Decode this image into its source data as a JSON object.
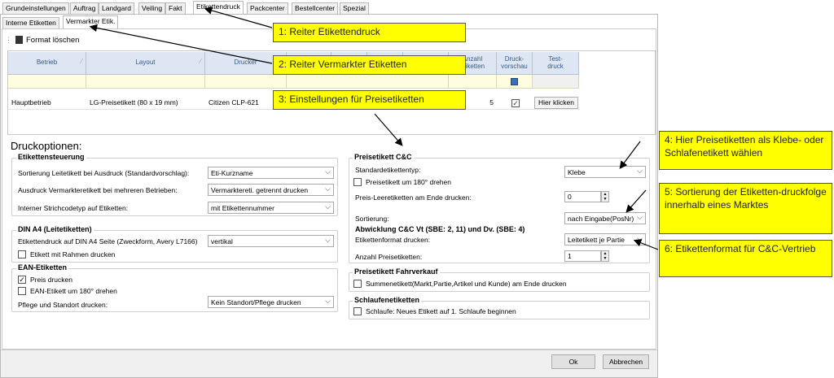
{
  "tabs": [
    "Grundeinstellungen",
    "Auftrag",
    "Landgard",
    "Veiling",
    "Fakt",
    "Etikettendruck",
    "Packcenter",
    "Bestellcenter",
    "Spezial"
  ],
  "subtabs": [
    "Interne Etiketten",
    "Vermarkter Etik."
  ],
  "toolbar": {
    "delete_label": "Format löschen"
  },
  "grid": {
    "headers": {
      "betrieb": "Betrieb",
      "layout": "Layout",
      "drucker": "Drucker",
      "anzahl": "Anzahl\netiketten",
      "vorschau": "Druck-\nvorschau",
      "test": "Test-\ndruck"
    },
    "row": {
      "betrieb": "Hauptbetrieb",
      "layout": "LG-Preisetikett (80 x 19 mm)",
      "drucker": "Citizen CLP-621",
      "anzahl": "5",
      "test": "Hier klicken"
    }
  },
  "druckoptionen": {
    "title": "Druckoptionen:",
    "steuerung": {
      "title": "Etikettensteuerung",
      "sort_label": "Sortierung Leitetikett bei Ausdruck (Standardvorschlag):",
      "sort_value": "Eti-Kurzname",
      "vermarkter_label": "Ausdruck Vermarkteretikett bei mehreren Betrieben:",
      "vermarkter_value": "Vermarktereti. getrennt drucken",
      "strichcode_label": "Interner Strichcodetyp auf Etiketten:",
      "strichcode_value": "mit Etikettennummer"
    },
    "dina4": {
      "title": "DIN A4 (Leitetiketten)",
      "label": "Etikettendruck auf DIN A4 Seite (Zweckform, Avery L7166)",
      "value": "vertikal",
      "rahmen_label": "Etikett mit Rahmen drucken"
    },
    "ean": {
      "title": "EAN-Etiketten",
      "preis_label": "Preis drucken",
      "drehen_label": "EAN-Etikett um 180° drehen",
      "pflege_label": "Pflege und Standort drucken:",
      "pflege_value": "Kein Standort/Pflege drucken"
    },
    "cc": {
      "title": "Preisetikett C&C",
      "std_label": "Standardetikettentyp:",
      "std_value": "Klebe",
      "drehen_label": "Preisetikett um 180° drehen",
      "leer_label": "Preis-Leeretiketten am Ende drucken:",
      "leer_value": "0",
      "sort_label": "Sortierung:",
      "sort_value": "nach Eingabe(PosNr)",
      "abw_title": "Abwicklung C&C Vt (SBE: 2, 11) und Dv. (SBE: 4)",
      "format_label": "Etikettenformat drucken:",
      "format_value": "Leitetikett je Partie",
      "anzahl_label": "Anzahl Preisetiketten:",
      "anzahl_value": "1"
    },
    "fahr": {
      "title": "Preisetikett Fahrverkauf",
      "summe_label": "Summenetikett(Markt,Partie,Artikel und Kunde) am Ende drucken"
    },
    "schlaufe": {
      "title": "Schlaufenetiketten",
      "label": "Schlaufe: Neues Etikett auf 1. Schlaufe beginnen"
    }
  },
  "buttons": {
    "ok": "Ok",
    "cancel": "Abbrechen"
  },
  "annotations": [
    "1: Reiter Etikettendruck",
    "2: Reiter Vermarkter Etiketten",
    "3: Einstellungen für Preisetiketten",
    "4: Hier Preisetiketten als Klebe- oder Schlafenetikett  wählen",
    "5: Sortierung der Etiketten-druckfolge innerhalb eines Marktes",
    "6: Etikettenformat für C&C-Vertrieb"
  ]
}
